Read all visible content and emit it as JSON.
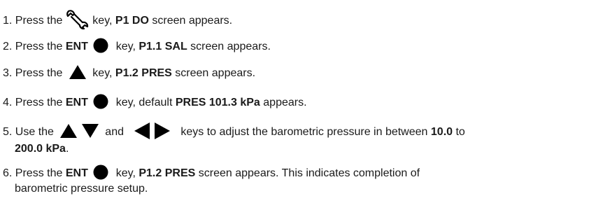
{
  "steps": [
    {
      "num": "1.",
      "t1": "Press the",
      "icon": "wrench-icon",
      "t2": "key,",
      "b1": "P1 DO",
      "t3": "screen appears."
    },
    {
      "num": "2.",
      "t1": "Press the",
      "b1": "ENT",
      "icon": "circle-enter-icon",
      "t2": "key,",
      "b2": "P1.1 SAL",
      "t3": "screen appears."
    },
    {
      "num": "3.",
      "t1": "Press the",
      "icon": "triangle-up-icon",
      "t2": "key,",
      "b1": "P1.2 PRES",
      "t3": "screen appears."
    },
    {
      "num": "4.",
      "t1": "Press the",
      "b1": "ENT",
      "icon": "circle-enter-icon",
      "t2": "key, default",
      "b2": "PRES 101.3 kPa",
      "t3": "appears."
    },
    {
      "num": "5.",
      "t1": "Use the",
      "icons": [
        "triangle-up-icon",
        "triangle-down-icon",
        "triangle-left-icon",
        "triangle-right-icon"
      ],
      "and": "and",
      "t2": "keys to adjust the barometric pressure in between",
      "b1": "10.0",
      "t3": "to",
      "b2": "200.0 kPa",
      "t4": "."
    },
    {
      "num": "6.",
      "t1": "Press the",
      "b1": "ENT",
      "icon": "circle-enter-icon",
      "t2": "key,",
      "b2": "P1.2 PRES",
      "t3": "screen appears. This indicates completion of",
      "t4": "barometric pressure setup."
    }
  ],
  "colors": {
    "text": "#1a1a1a",
    "icon": "#000000"
  }
}
